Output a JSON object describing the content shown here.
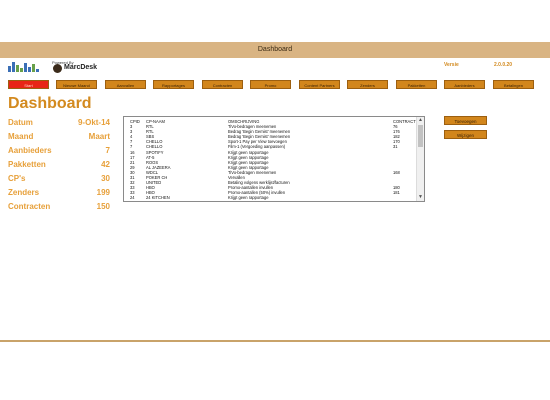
{
  "window": {
    "title": "Dashboard"
  },
  "header": {
    "powered_by": "Powered By",
    "brand": "MarcDesk",
    "version_label": "Versie",
    "version_value": "2.0.0.20"
  },
  "nav": {
    "items": [
      {
        "label": "Start"
      },
      {
        "label": "Nieuwe Maand"
      },
      {
        "label": "Aanvallen"
      },
      {
        "label": "Rapportages"
      },
      {
        "label": "Contracten"
      },
      {
        "label": "Promo"
      },
      {
        "label": "Content Partners"
      },
      {
        "label": "Zenders"
      },
      {
        "label": "Pakketten"
      },
      {
        "label": "Aanbieders"
      },
      {
        "label": "Betalingen"
      }
    ]
  },
  "page": {
    "title": "Dashboard"
  },
  "stats": [
    {
      "label": "Datum",
      "value": "9-Okt-14"
    },
    {
      "label": "Maand",
      "value": "Maart"
    },
    {
      "label": "Aanbieders",
      "value": "7"
    },
    {
      "label": "Pakketten",
      "value": "42"
    },
    {
      "label": "CP's",
      "value": "30"
    },
    {
      "label": "Zenders",
      "value": "199"
    },
    {
      "label": "Contracten",
      "value": "150"
    }
  ],
  "list": {
    "headers": {
      "id": "CPID",
      "name": "CP-NAAM",
      "desc": "OMSCHRIJVING",
      "contract": "CONTRACT"
    },
    "rows": [
      {
        "id": "3",
        "name": "RTL",
        "desc": "TiVo-bedragen meenemen",
        "contract": "76"
      },
      {
        "id": "3",
        "name": "RTL",
        "desc": "Bedrag 'Begin Gemist' meenemen",
        "contract": "176"
      },
      {
        "id": "4",
        "name": "SBS",
        "desc": "Bedrag 'Begin Gemist' meenemen",
        "contract": "182"
      },
      {
        "id": "7",
        "name": "CHELLO",
        "desc": "Sport-1 Pay per View toevoegen",
        "contract": "170"
      },
      {
        "id": "7",
        "name": "CHELLO",
        "desc": "Film-1 (Vergoeding aanpassen)",
        "contract": "31"
      },
      {
        "id": "16",
        "name": "SPOTIFY",
        "desc": "Krijgt geen rapportage",
        "contract": ""
      },
      {
        "id": "17",
        "name": "AT-5",
        "desc": "Krijgt geen rapportage",
        "contract": ""
      },
      {
        "id": "21",
        "name": "ROOS",
        "desc": "Krijgt geen rapportage",
        "contract": ""
      },
      {
        "id": "29",
        "name": "AL JAZEERA",
        "desc": "Krijgt geen rapportage",
        "contract": ""
      },
      {
        "id": "30",
        "name": "WDCL",
        "desc": "TiVo-bedragen meenemen",
        "contract": "168"
      },
      {
        "id": "31",
        "name": "POKER CH",
        "desc": "Vervallen",
        "contract": ""
      },
      {
        "id": "32",
        "name": "UNITED",
        "desc": "Betaling volgens werklijst/facturen",
        "contract": ""
      },
      {
        "id": "33",
        "name": "HBO",
        "desc": "Promo-aantallen invullen",
        "contract": "180"
      },
      {
        "id": "33",
        "name": "HBO",
        "desc": "Promo-aantallen (50%) invullen",
        "contract": "181"
      },
      {
        "id": "24",
        "name": "24 KITCHEN",
        "desc": "Krijgt geen rapportage",
        "contract": ""
      }
    ]
  },
  "actions": {
    "add_label": "Toevoegen",
    "delete_label": "Wijzigen"
  },
  "colors": {
    "accent": "#d2861c",
    "active": "#e82517",
    "title": "#d38a1f"
  }
}
